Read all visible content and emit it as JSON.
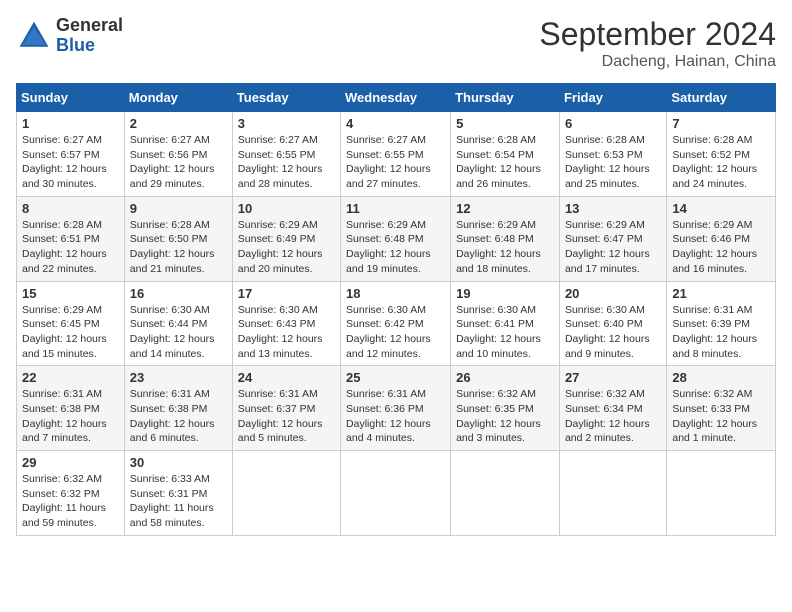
{
  "header": {
    "logo_general": "General",
    "logo_blue": "Blue",
    "month": "September 2024",
    "location": "Dacheng, Hainan, China"
  },
  "weekdays": [
    "Sunday",
    "Monday",
    "Tuesday",
    "Wednesday",
    "Thursday",
    "Friday",
    "Saturday"
  ],
  "weeks": [
    [
      {
        "day": "1",
        "sunrise": "6:27 AM",
        "sunset": "6:57 PM",
        "daylight": "12 hours and 30 minutes."
      },
      {
        "day": "2",
        "sunrise": "6:27 AM",
        "sunset": "6:56 PM",
        "daylight": "12 hours and 29 minutes."
      },
      {
        "day": "3",
        "sunrise": "6:27 AM",
        "sunset": "6:55 PM",
        "daylight": "12 hours and 28 minutes."
      },
      {
        "day": "4",
        "sunrise": "6:27 AM",
        "sunset": "6:55 PM",
        "daylight": "12 hours and 27 minutes."
      },
      {
        "day": "5",
        "sunrise": "6:28 AM",
        "sunset": "6:54 PM",
        "daylight": "12 hours and 26 minutes."
      },
      {
        "day": "6",
        "sunrise": "6:28 AM",
        "sunset": "6:53 PM",
        "daylight": "12 hours and 25 minutes."
      },
      {
        "day": "7",
        "sunrise": "6:28 AM",
        "sunset": "6:52 PM",
        "daylight": "12 hours and 24 minutes."
      }
    ],
    [
      {
        "day": "8",
        "sunrise": "6:28 AM",
        "sunset": "6:51 PM",
        "daylight": "12 hours and 22 minutes."
      },
      {
        "day": "9",
        "sunrise": "6:28 AM",
        "sunset": "6:50 PM",
        "daylight": "12 hours and 21 minutes."
      },
      {
        "day": "10",
        "sunrise": "6:29 AM",
        "sunset": "6:49 PM",
        "daylight": "12 hours and 20 minutes."
      },
      {
        "day": "11",
        "sunrise": "6:29 AM",
        "sunset": "6:48 PM",
        "daylight": "12 hours and 19 minutes."
      },
      {
        "day": "12",
        "sunrise": "6:29 AM",
        "sunset": "6:48 PM",
        "daylight": "12 hours and 18 minutes."
      },
      {
        "day": "13",
        "sunrise": "6:29 AM",
        "sunset": "6:47 PM",
        "daylight": "12 hours and 17 minutes."
      },
      {
        "day": "14",
        "sunrise": "6:29 AM",
        "sunset": "6:46 PM",
        "daylight": "12 hours and 16 minutes."
      }
    ],
    [
      {
        "day": "15",
        "sunrise": "6:29 AM",
        "sunset": "6:45 PM",
        "daylight": "12 hours and 15 minutes."
      },
      {
        "day": "16",
        "sunrise": "6:30 AM",
        "sunset": "6:44 PM",
        "daylight": "12 hours and 14 minutes."
      },
      {
        "day": "17",
        "sunrise": "6:30 AM",
        "sunset": "6:43 PM",
        "daylight": "12 hours and 13 minutes."
      },
      {
        "day": "18",
        "sunrise": "6:30 AM",
        "sunset": "6:42 PM",
        "daylight": "12 hours and 12 minutes."
      },
      {
        "day": "19",
        "sunrise": "6:30 AM",
        "sunset": "6:41 PM",
        "daylight": "12 hours and 10 minutes."
      },
      {
        "day": "20",
        "sunrise": "6:30 AM",
        "sunset": "6:40 PM",
        "daylight": "12 hours and 9 minutes."
      },
      {
        "day": "21",
        "sunrise": "6:31 AM",
        "sunset": "6:39 PM",
        "daylight": "12 hours and 8 minutes."
      }
    ],
    [
      {
        "day": "22",
        "sunrise": "6:31 AM",
        "sunset": "6:38 PM",
        "daylight": "12 hours and 7 minutes."
      },
      {
        "day": "23",
        "sunrise": "6:31 AM",
        "sunset": "6:38 PM",
        "daylight": "12 hours and 6 minutes."
      },
      {
        "day": "24",
        "sunrise": "6:31 AM",
        "sunset": "6:37 PM",
        "daylight": "12 hours and 5 minutes."
      },
      {
        "day": "25",
        "sunrise": "6:31 AM",
        "sunset": "6:36 PM",
        "daylight": "12 hours and 4 minutes."
      },
      {
        "day": "26",
        "sunrise": "6:32 AM",
        "sunset": "6:35 PM",
        "daylight": "12 hours and 3 minutes."
      },
      {
        "day": "27",
        "sunrise": "6:32 AM",
        "sunset": "6:34 PM",
        "daylight": "12 hours and 2 minutes."
      },
      {
        "day": "28",
        "sunrise": "6:32 AM",
        "sunset": "6:33 PM",
        "daylight": "12 hours and 1 minute."
      }
    ],
    [
      {
        "day": "29",
        "sunrise": "6:32 AM",
        "sunset": "6:32 PM",
        "daylight": "11 hours and 59 minutes."
      },
      {
        "day": "30",
        "sunrise": "6:33 AM",
        "sunset": "6:31 PM",
        "daylight": "11 hours and 58 minutes."
      },
      null,
      null,
      null,
      null,
      null
    ]
  ]
}
